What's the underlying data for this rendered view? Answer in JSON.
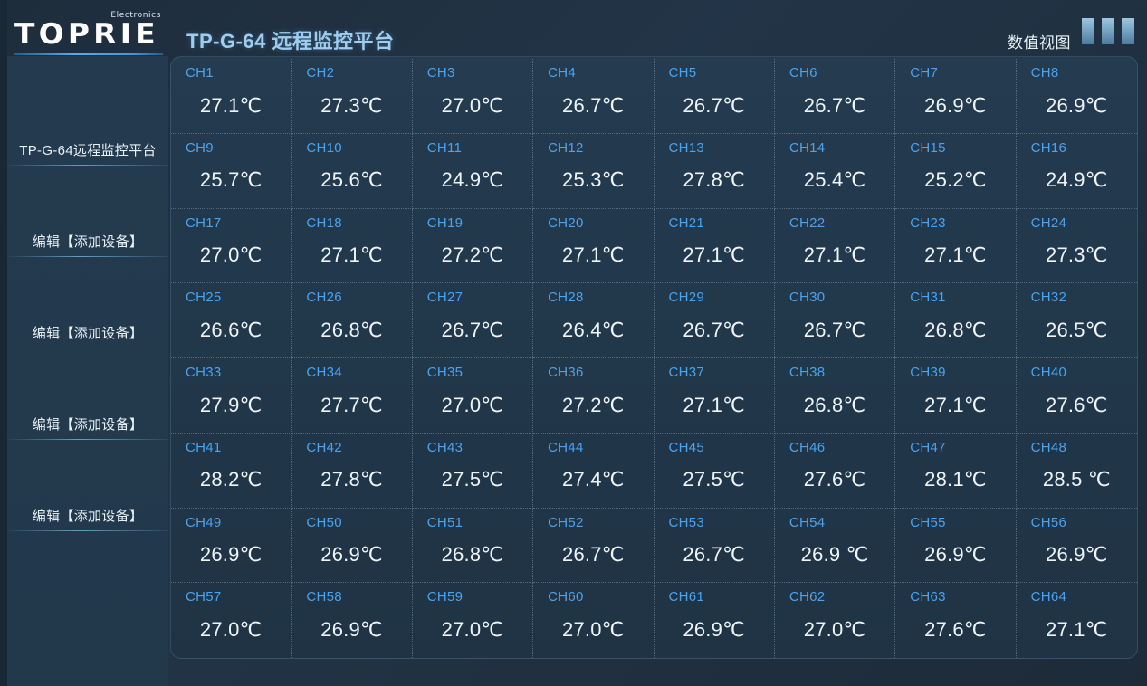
{
  "brand": {
    "superscript": "Electronics",
    "wordmark": "TOPRIE"
  },
  "header": {
    "title": "TP-G-64 远程监控平台",
    "view_mode_label": "数值视图",
    "menu_icon": "three-bars-icon"
  },
  "sidebar": {
    "title": "TP-G-64远程监控平台",
    "items": [
      {
        "label": "编辑【添加设备】"
      },
      {
        "label": "编辑【添加设备】"
      },
      {
        "label": "编辑【添加设备】"
      },
      {
        "label": "编辑【添加设备】"
      }
    ]
  },
  "colors": {
    "page_bg": "#223447",
    "panel_bg": "#21374a",
    "accent_blue": "#4aa3ef",
    "title_blue": "#9fcdf0",
    "value_white": "#eef4fa",
    "grid_line": "#a6bed2"
  },
  "grid": {
    "columns": 8,
    "rows": 8,
    "unit": "℃",
    "channels": [
      {
        "label": "CH1",
        "value": "27.1℃"
      },
      {
        "label": "CH2",
        "value": "27.3℃"
      },
      {
        "label": "CH3",
        "value": "27.0℃"
      },
      {
        "label": "CH4",
        "value": "26.7℃"
      },
      {
        "label": "CH5",
        "value": "26.7℃"
      },
      {
        "label": "CH6",
        "value": "26.7℃"
      },
      {
        "label": "CH7",
        "value": "26.9℃"
      },
      {
        "label": "CH8",
        "value": "26.9℃"
      },
      {
        "label": "CH9",
        "value": "25.7℃"
      },
      {
        "label": "CH10",
        "value": "25.6℃"
      },
      {
        "label": "CH11",
        "value": "24.9℃"
      },
      {
        "label": "CH12",
        "value": "25.3℃"
      },
      {
        "label": "CH13",
        "value": "27.8℃"
      },
      {
        "label": "CH14",
        "value": "25.4℃"
      },
      {
        "label": "CH15",
        "value": "25.2℃"
      },
      {
        "label": "CH16",
        "value": "24.9℃"
      },
      {
        "label": "CH17",
        "value": "27.0℃"
      },
      {
        "label": "CH18",
        "value": "27.1℃"
      },
      {
        "label": "CH19",
        "value": "27.2℃"
      },
      {
        "label": "CH20",
        "value": "27.1℃"
      },
      {
        "label": "CH21",
        "value": "27.1℃"
      },
      {
        "label": "CH22",
        "value": "27.1℃"
      },
      {
        "label": "CH23",
        "value": "27.1℃"
      },
      {
        "label": "CH24",
        "value": "27.3℃"
      },
      {
        "label": "CH25",
        "value": "26.6℃"
      },
      {
        "label": "CH26",
        "value": "26.8℃"
      },
      {
        "label": "CH27",
        "value": "26.7℃"
      },
      {
        "label": "CH28",
        "value": "26.4℃"
      },
      {
        "label": "CH29",
        "value": "26.7℃"
      },
      {
        "label": "CH30",
        "value": "26.7℃"
      },
      {
        "label": "CH31",
        "value": "26.8℃"
      },
      {
        "label": "CH32",
        "value": "26.5℃"
      },
      {
        "label": "CH33",
        "value": "27.9℃"
      },
      {
        "label": "CH34",
        "value": "27.7℃"
      },
      {
        "label": "CH35",
        "value": "27.0℃"
      },
      {
        "label": "CH36",
        "value": "27.2℃"
      },
      {
        "label": "CH37",
        "value": "27.1℃"
      },
      {
        "label": "CH38",
        "value": "26.8℃"
      },
      {
        "label": "CH39",
        "value": "27.1℃"
      },
      {
        "label": "CH40",
        "value": "27.6℃"
      },
      {
        "label": "CH41",
        "value": "28.2℃"
      },
      {
        "label": "CH42",
        "value": "27.8℃"
      },
      {
        "label": "CH43",
        "value": "27.5℃"
      },
      {
        "label": "CH44",
        "value": "27.4℃"
      },
      {
        "label": "CH45",
        "value": "27.5℃"
      },
      {
        "label": "CH46",
        "value": "27.6℃"
      },
      {
        "label": "CH47",
        "value": "28.1℃"
      },
      {
        "label": "CH48",
        "value": "28.5 ℃"
      },
      {
        "label": "CH49",
        "value": "26.9℃"
      },
      {
        "label": "CH50",
        "value": "26.9℃"
      },
      {
        "label": "CH51",
        "value": "26.8℃"
      },
      {
        "label": "CH52",
        "value": "26.7℃"
      },
      {
        "label": "CH53",
        "value": "26.7℃"
      },
      {
        "label": "CH54",
        "value": "26.9 ℃"
      },
      {
        "label": "CH55",
        "value": "26.9℃"
      },
      {
        "label": "CH56",
        "value": "26.9℃"
      },
      {
        "label": "CH57",
        "value": "27.0℃"
      },
      {
        "label": "CH58",
        "value": "26.9℃"
      },
      {
        "label": "CH59",
        "value": "27.0℃"
      },
      {
        "label": "CH60",
        "value": "27.0℃"
      },
      {
        "label": "CH61",
        "value": "26.9℃"
      },
      {
        "label": "CH62",
        "value": "27.0℃"
      },
      {
        "label": "CH63",
        "value": "27.6℃"
      },
      {
        "label": "CH64",
        "value": "27.1℃"
      }
    ]
  }
}
